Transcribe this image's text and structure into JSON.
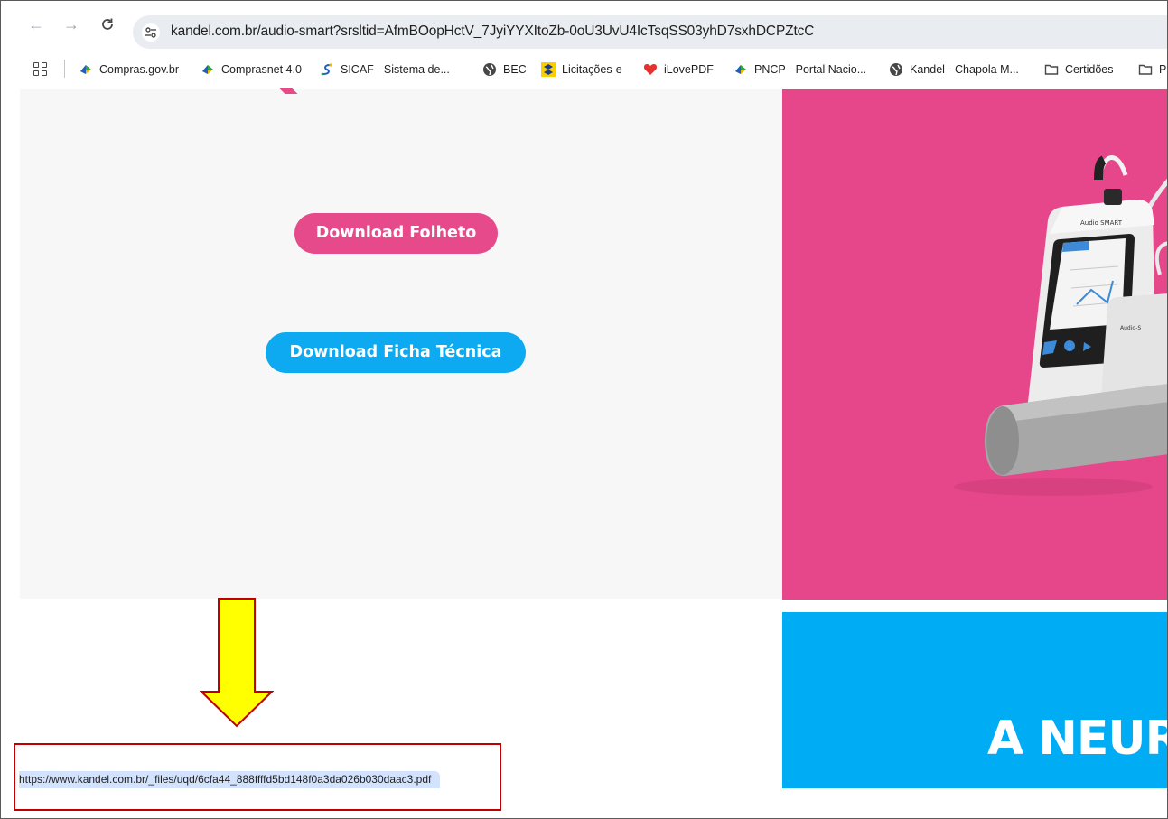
{
  "browser": {
    "url": "kandel.com.br/audio-smart?srsltid=AfmBOopHctV_7JyiYYXItoZb-0oU3UvU4IcTsqSS03yhD7sxhDCPZtcC",
    "nav": {
      "back": "←",
      "forward": "→",
      "reload": "C"
    }
  },
  "bookmarks": [
    {
      "label": "Compras.gov.br",
      "icon": "govbr-icon"
    },
    {
      "label": "Comprasnet 4.0",
      "icon": "govbr-icon"
    },
    {
      "label": "SICAF - Sistema de...",
      "icon": "sicaf-icon"
    },
    {
      "label": "BEC",
      "icon": "globe-icon"
    },
    {
      "label": "Licitações-e",
      "icon": "bb-icon"
    },
    {
      "label": "iLovePDF",
      "icon": "heart-icon"
    },
    {
      "label": "PNCP - Portal Nacio...",
      "icon": "govbr-icon"
    },
    {
      "label": "Kandel - Chapola M...",
      "icon": "globe-icon"
    },
    {
      "label": "Certidões",
      "icon": "folder-icon"
    },
    {
      "label": "P",
      "icon": "folder-icon"
    }
  ],
  "page": {
    "download_folheto": "Download Folheto",
    "download_ficha": "Download Ficha Técnica",
    "banner_text": "A NEUR"
  },
  "status_bar": {
    "url": "https://www.kandel.com.br/_files/uqd/6cfa44_888ffffd5bd148f0a3da026b030daac3.pdf"
  },
  "colors": {
    "pink": "#e64a8b",
    "blue": "#0eaaf1",
    "annotation_arrow": "#ffff00",
    "annotation_box": "#c00000"
  }
}
